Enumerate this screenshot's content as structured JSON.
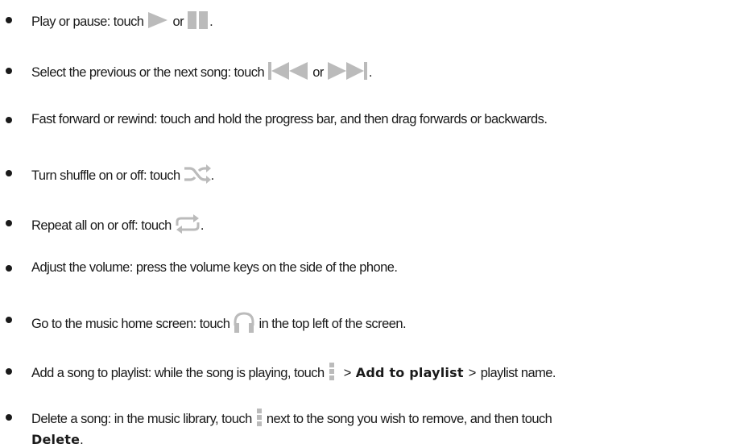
{
  "items": [
    {
      "text_before": "Play or pause: touch",
      "connector": "or",
      "text_after": ".",
      "icons": [
        "play-icon",
        "pause-icon"
      ]
    },
    {
      "text_before": "Select the previous or the next song: touch",
      "connector": "or",
      "text_after": ".",
      "icons": [
        "previous-track-icon",
        "next-track-icon"
      ]
    },
    {
      "text": "Fast forward or rewind: touch and hold the progress bar, and then drag forwards or backwards."
    },
    {
      "text_before": "Turn shuffle on or off: touch",
      "text_after": ".",
      "icons": [
        "shuffle-icon"
      ]
    },
    {
      "text_before": "Repeat all on or off: touch",
      "text_after": ".",
      "icons": [
        "repeat-icon"
      ]
    },
    {
      "text": "Adjust the volume: press the volume keys on the side of the phone."
    },
    {
      "text_before": "Go to the music home screen: touch",
      "text_after": "in the top left of the screen.",
      "icons": [
        "headphones-icon"
      ]
    },
    {
      "text_before": "Add a song to playlist: while the song is playing, touch",
      "sep": ">",
      "bold": "Add to playlist",
      "text_after": "playlist name.",
      "icons": [
        "menu-icon"
      ]
    },
    {
      "text_before": "Delete a song: in the music library, touch",
      "text_after": "next to the song you wish to remove, and then touch",
      "bold": "Delete",
      "end": ".",
      "icons": [
        "menu-icon"
      ]
    }
  ],
  "colors": {
    "text": "#1a1a1a",
    "icon": "#bbbbbb"
  }
}
